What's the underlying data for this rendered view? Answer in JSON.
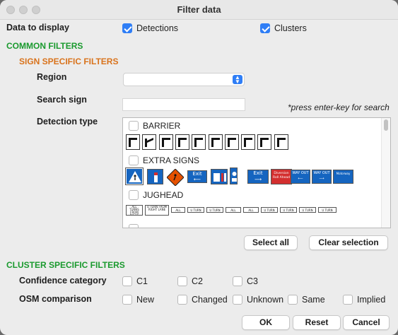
{
  "window": {
    "title": "Filter data"
  },
  "display": {
    "label": "Data to display",
    "detections": {
      "label": "Detections",
      "checked": true
    },
    "clusters": {
      "label": "Clusters",
      "checked": true
    }
  },
  "common_filters": {
    "heading": "COMMON FILTERS",
    "sign_specific": {
      "heading": "SIGN SPECIFIC FILTERS",
      "region_label": "Region",
      "region_value": "",
      "search_label": "Search sign",
      "search_value": "",
      "search_hint": "*press enter-key for search",
      "detection_type_label": "Detection type",
      "groups": [
        {
          "name": "BARRIER",
          "checked": false,
          "icon_count": 10
        },
        {
          "name": "EXTRA SIGNS",
          "checked": false,
          "icons": [
            "pedestrian-crossing-sign",
            "info-blue-sign",
            "roadwork-diamond-sign",
            "exit-left-sign",
            "exit-lane-sign",
            "bus-stop-sign",
            "exit-right-sign",
            "diversion-red-sign",
            "way-out-left-sign",
            "way-out-right-sign",
            "motorway-notice-sign"
          ],
          "icon_texts": [
            "",
            "",
            "",
            "Exit",
            "",
            "",
            "Exit",
            "Diversion Roll Ahead",
            "WAY OUT",
            "WAY OUT",
            "Motorway"
          ]
        },
        {
          "name": "JUGHEAD",
          "checked": false,
          "icon_texts": [
            "ALL TURNS FROM RIGHT LANE",
            "U TURN FROM RIGHT LANE",
            "ALL TURNS",
            "U TURN",
            "U TURN",
            "ALL TURNS",
            "ALL TURNS",
            "U TURN",
            "U TURN",
            "U TURN",
            "U TURN"
          ]
        }
      ],
      "select_all": "Select all",
      "clear_selection": "Clear selection"
    }
  },
  "cluster_filters": {
    "heading": "CLUSTER SPECIFIC FILTERS",
    "confidence_label": "Confidence category",
    "confidence_options": [
      {
        "label": "C1",
        "checked": false
      },
      {
        "label": "C2",
        "checked": false
      },
      {
        "label": "C3",
        "checked": false
      }
    ],
    "osm_label": "OSM comparison",
    "osm_options": [
      {
        "label": "New",
        "checked": false
      },
      {
        "label": "Changed",
        "checked": false
      },
      {
        "label": "Unknown",
        "checked": false
      },
      {
        "label": "Same",
        "checked": false
      },
      {
        "label": "Implied",
        "checked": false
      }
    ]
  },
  "footer": {
    "ok": "OK",
    "reset": "Reset",
    "cancel": "Cancel"
  },
  "colors": {
    "accent": "#2f7ef6",
    "green_heading": "#1a9a2e",
    "orange_heading": "#d9731c"
  }
}
